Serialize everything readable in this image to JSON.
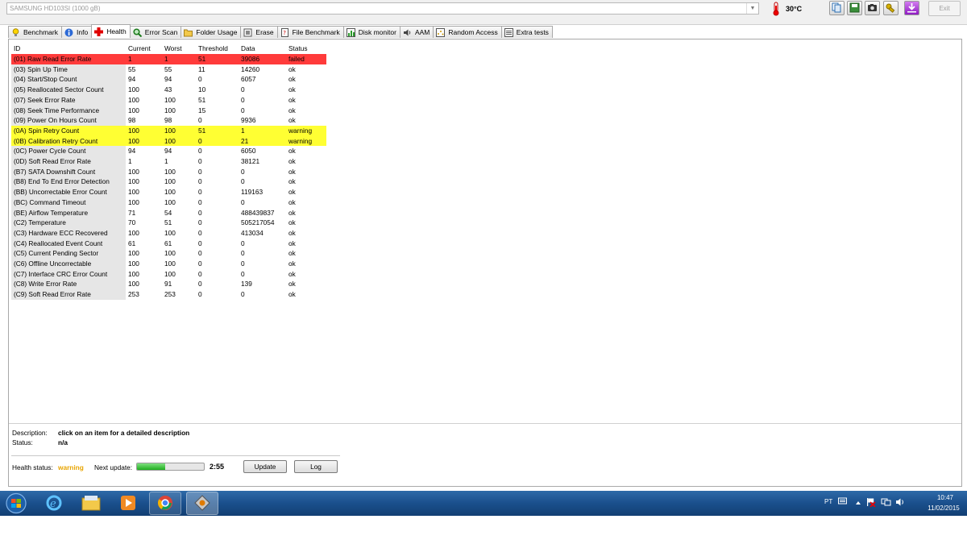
{
  "toolbar": {
    "drive": "SAMSUNG HD103SI (1000 gB)",
    "temperature": "30°C",
    "exit_label": "Exit",
    "buttons": [
      "copy-icon",
      "save-icon",
      "camera-icon",
      "settings-icon",
      "download-icon"
    ]
  },
  "tabs": [
    {
      "label": "Benchmark",
      "icon": "benchmark-icon"
    },
    {
      "label": "Info",
      "icon": "info-icon"
    },
    {
      "label": "Health",
      "icon": "health-cross-icon",
      "active": true
    },
    {
      "label": "Error Scan",
      "icon": "magnifier-icon"
    },
    {
      "label": "Folder Usage",
      "icon": "folder-icon"
    },
    {
      "label": "Erase",
      "icon": "erase-icon"
    },
    {
      "label": "File Benchmark",
      "icon": "file-benchmark-icon"
    },
    {
      "label": "Disk monitor",
      "icon": "disk-monitor-icon"
    },
    {
      "label": "AAM",
      "icon": "speaker-icon"
    },
    {
      "label": "Random Access",
      "icon": "random-access-icon"
    },
    {
      "label": "Extra tests",
      "icon": "extra-tests-icon"
    }
  ],
  "table": {
    "headers": [
      "ID",
      "Current",
      "Worst",
      "Threshold",
      "Data",
      "Status"
    ],
    "rows": [
      {
        "id": "(01) Raw Read Error Rate",
        "current": "1",
        "worst": "1",
        "threshold": "51",
        "data": "39086",
        "status": "failed"
      },
      {
        "id": "(03) Spin Up Time",
        "current": "55",
        "worst": "55",
        "threshold": "11",
        "data": "14260",
        "status": "ok"
      },
      {
        "id": "(04) Start/Stop Count",
        "current": "94",
        "worst": "94",
        "threshold": "0",
        "data": "6057",
        "status": "ok"
      },
      {
        "id": "(05) Reallocated Sector Count",
        "current": "100",
        "worst": "43",
        "threshold": "10",
        "data": "0",
        "status": "ok"
      },
      {
        "id": "(07) Seek Error Rate",
        "current": "100",
        "worst": "100",
        "threshold": "51",
        "data": "0",
        "status": "ok"
      },
      {
        "id": "(08) Seek Time Performance",
        "current": "100",
        "worst": "100",
        "threshold": "15",
        "data": "0",
        "status": "ok"
      },
      {
        "id": "(09) Power On Hours Count",
        "current": "98",
        "worst": "98",
        "threshold": "0",
        "data": "9936",
        "status": "ok"
      },
      {
        "id": "(0A) Spin Retry Count",
        "current": "100",
        "worst": "100",
        "threshold": "51",
        "data": "1",
        "status": "warning"
      },
      {
        "id": "(0B) Calibration Retry Count",
        "current": "100",
        "worst": "100",
        "threshold": "0",
        "data": "21",
        "status": "warning"
      },
      {
        "id": "(0C) Power Cycle Count",
        "current": "94",
        "worst": "94",
        "threshold": "0",
        "data": "6050",
        "status": "ok"
      },
      {
        "id": "(0D) Soft Read Error Rate",
        "current": "1",
        "worst": "1",
        "threshold": "0",
        "data": "38121",
        "status": "ok"
      },
      {
        "id": "(B7) SATA Downshift Count",
        "current": "100",
        "worst": "100",
        "threshold": "0",
        "data": "0",
        "status": "ok"
      },
      {
        "id": "(B8) End To End Error Detection",
        "current": "100",
        "worst": "100",
        "threshold": "0",
        "data": "0",
        "status": "ok"
      },
      {
        "id": "(BB) Uncorrectable Error Count",
        "current": "100",
        "worst": "100",
        "threshold": "0",
        "data": "119163",
        "status": "ok"
      },
      {
        "id": "(BC) Command Timeout",
        "current": "100",
        "worst": "100",
        "threshold": "0",
        "data": "0",
        "status": "ok"
      },
      {
        "id": "(BE) Airflow Temperature",
        "current": "71",
        "worst": "54",
        "threshold": "0",
        "data": "488439837",
        "status": "ok"
      },
      {
        "id": "(C2) Temperature",
        "current": "70",
        "worst": "51",
        "threshold": "0",
        "data": "505217054",
        "status": "ok"
      },
      {
        "id": "(C3) Hardware ECC Recovered",
        "current": "100",
        "worst": "100",
        "threshold": "0",
        "data": "413034",
        "status": "ok"
      },
      {
        "id": "(C4) Reallocated Event Count",
        "current": "61",
        "worst": "61",
        "threshold": "0",
        "data": "0",
        "status": "ok"
      },
      {
        "id": "(C5) Current Pending Sector",
        "current": "100",
        "worst": "100",
        "threshold": "0",
        "data": "0",
        "status": "ok"
      },
      {
        "id": "(C6) Offline Uncorrectable",
        "current": "100",
        "worst": "100",
        "threshold": "0",
        "data": "0",
        "status": "ok"
      },
      {
        "id": "(C7) Interface CRC Error Count",
        "current": "100",
        "worst": "100",
        "threshold": "0",
        "data": "0",
        "status": "ok"
      },
      {
        "id": "(C8) Write Error Rate",
        "current": "100",
        "worst": "91",
        "threshold": "0",
        "data": "139",
        "status": "ok"
      },
      {
        "id": "(C9) Soft Read Error Rate",
        "current": "253",
        "worst": "253",
        "threshold": "0",
        "data": "0",
        "status": "ok"
      }
    ]
  },
  "details": {
    "description_label": "Description:",
    "description_value": "click on an item for a detailed description",
    "status_label": "Status:",
    "status_value": "n/a"
  },
  "footer": {
    "health_label": "Health status:",
    "health_value": "warning",
    "health_color": "#e8a400",
    "next_update_label": "Next update:",
    "countdown": "2:55",
    "progress": 0.42,
    "update_label": "Update",
    "log_label": "Log"
  },
  "colors": {
    "failed_row": "#ff3b3b",
    "warning_row": "#ffff33"
  },
  "taskbar": {
    "pinned": [
      "start-windows-icon",
      "internet-explorer-icon",
      "file-explorer-icon",
      "media-player-icon",
      "chrome-icon",
      "hd-tune-icon"
    ],
    "language": "PT",
    "time": "10:47",
    "date": "11/02/2015"
  }
}
